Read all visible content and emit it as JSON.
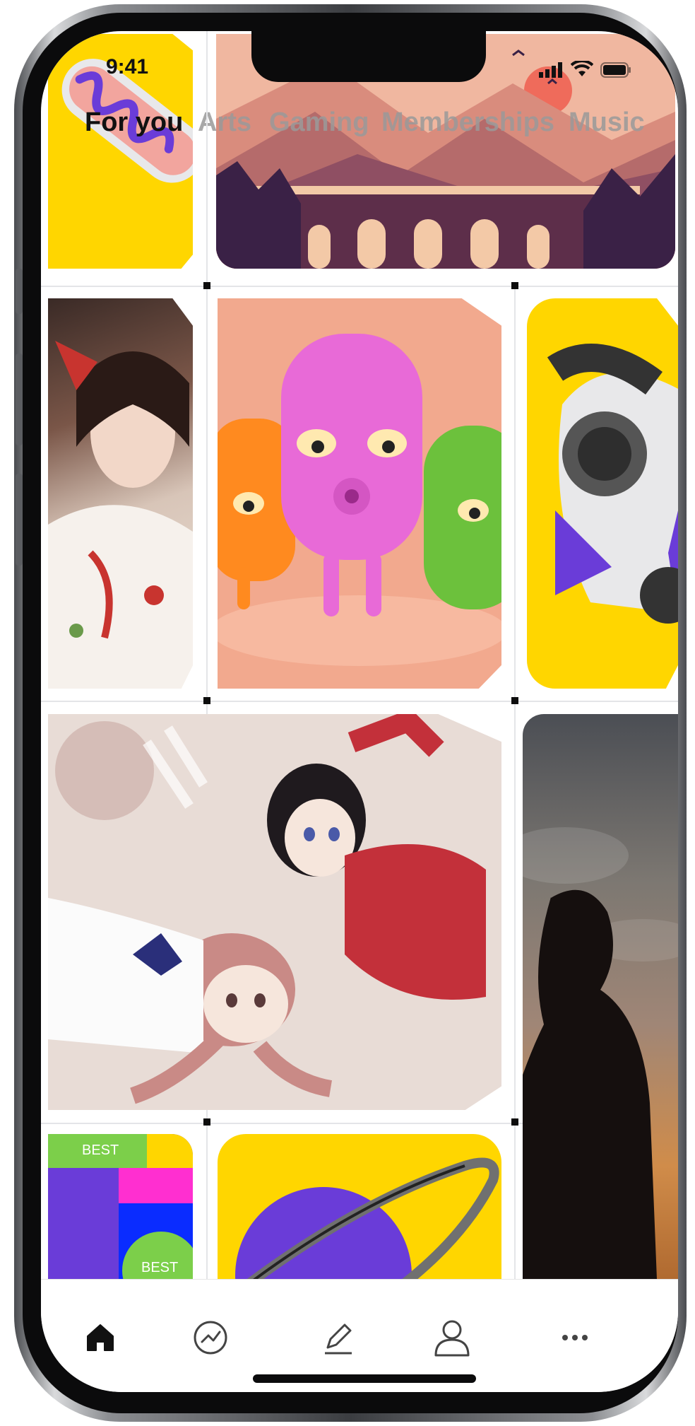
{
  "status_bar": {
    "time": "9:41"
  },
  "tabs": [
    {
      "label": "For you",
      "active": true
    },
    {
      "label": "Arts",
      "active": false
    },
    {
      "label": "Gaming",
      "active": false
    },
    {
      "label": "Memberships",
      "active": false
    },
    {
      "label": "Music",
      "active": false
    }
  ],
  "tiles": {
    "poster_labels": [
      "BEST",
      "BEST"
    ]
  },
  "bottom_nav": [
    {
      "icon": "home-icon",
      "active": true
    },
    {
      "icon": "activity-icon",
      "active": false
    },
    {
      "icon": "pencil-icon",
      "active": false
    },
    {
      "icon": "profile-icon",
      "active": false
    },
    {
      "icon": "more-icon",
      "active": false
    }
  ],
  "colors": {
    "accent_yellow": "#ffd600",
    "purple": "#6a3cd8",
    "tab_active": "#111111",
    "tab_inactive": "#9a9a9a"
  }
}
